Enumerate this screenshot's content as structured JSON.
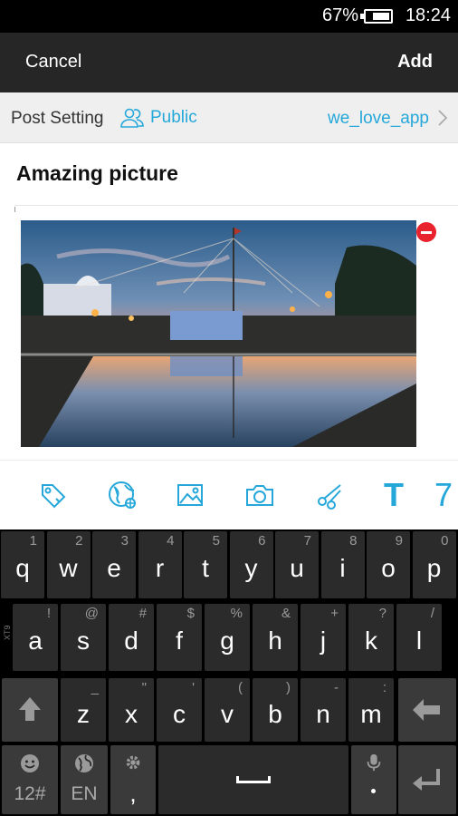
{
  "status": {
    "battery": "67%",
    "time": "18:24"
  },
  "actionbar": {
    "cancel": "Cancel",
    "add": "Add"
  },
  "post_setting": {
    "label": "Post Setting",
    "privacy": "Public",
    "group": "we_love_app"
  },
  "post": {
    "title": "Amazing picture"
  },
  "toolbar": {
    "text_tool": "T",
    "more_tool": "7"
  },
  "colors": {
    "accent": "#25a8d9",
    "remove": "#e8232e",
    "bar": "#262626"
  },
  "icons": [
    "tag-icon",
    "globe-icon",
    "image-icon",
    "camera-icon",
    "scissors-icon"
  ],
  "keyboard": {
    "row1": [
      {
        "k": "q",
        "h": "1"
      },
      {
        "k": "w",
        "h": "2"
      },
      {
        "k": "e",
        "h": "3"
      },
      {
        "k": "r",
        "h": "4"
      },
      {
        "k": "t",
        "h": "5"
      },
      {
        "k": "y",
        "h": "6"
      },
      {
        "k": "u",
        "h": "7"
      },
      {
        "k": "i",
        "h": "8"
      },
      {
        "k": "o",
        "h": "9"
      },
      {
        "k": "p",
        "h": "0"
      }
    ],
    "row2": [
      {
        "k": "a",
        "h": "!"
      },
      {
        "k": "s",
        "h": "@"
      },
      {
        "k": "d",
        "h": "#"
      },
      {
        "k": "f",
        "h": "$"
      },
      {
        "k": "g",
        "h": "%"
      },
      {
        "k": "h",
        "h": "&"
      },
      {
        "k": "j",
        "h": "+"
      },
      {
        "k": "k",
        "h": "?"
      },
      {
        "k": "l",
        "h": "/"
      }
    ],
    "row3": [
      {
        "k": "z",
        "h": "_"
      },
      {
        "k": "x",
        "h": "\""
      },
      {
        "k": "c",
        "h": "'"
      },
      {
        "k": "v",
        "h": "("
      },
      {
        "k": "b",
        "h": ")"
      },
      {
        "k": "n",
        "h": "-"
      },
      {
        "k": "m",
        "h": ":"
      }
    ],
    "symbols_label": "12#",
    "language_label": "EN",
    "comma": ","
  }
}
